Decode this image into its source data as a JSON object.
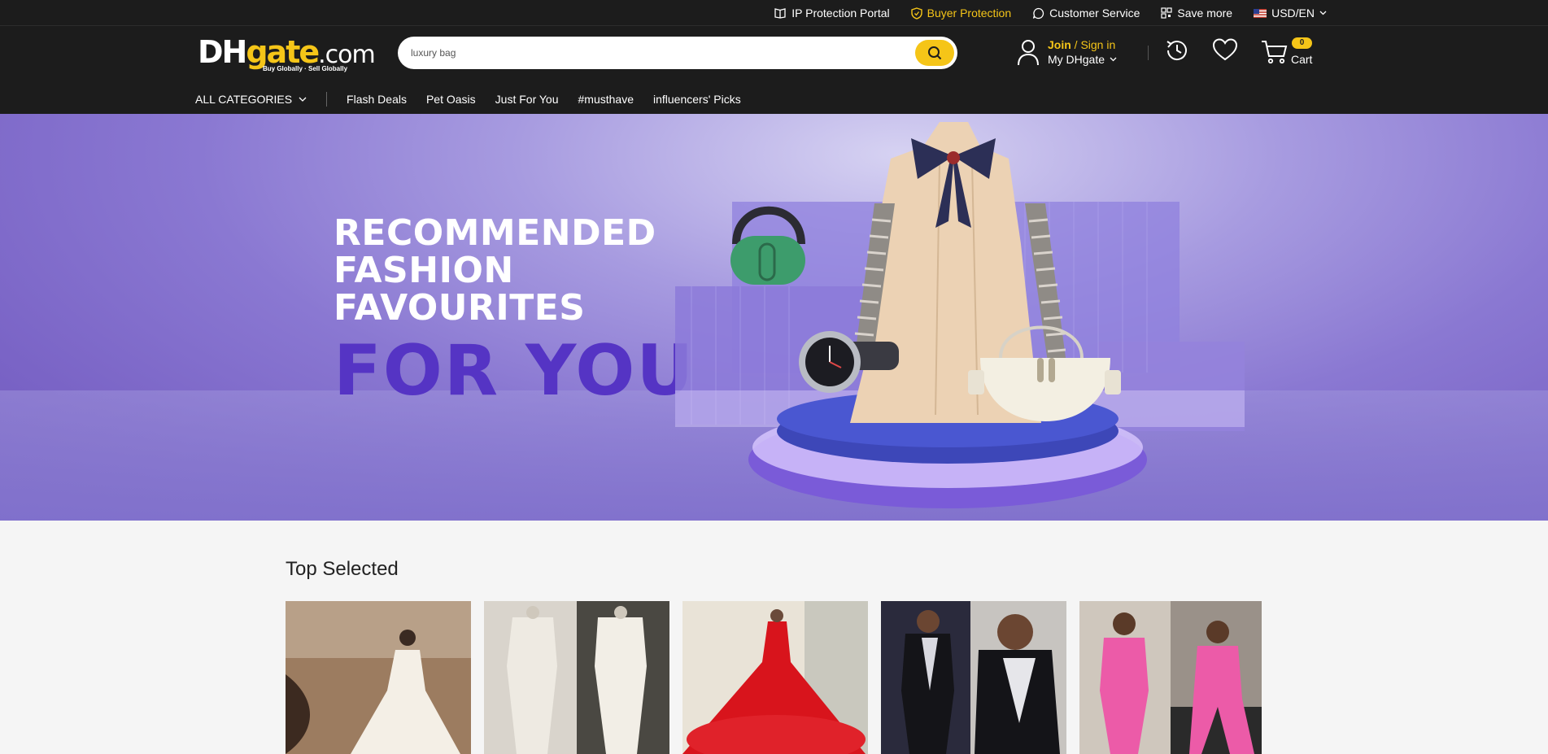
{
  "topbar": {
    "ip_protection": "IP Protection Portal",
    "buyer_protection": "Buyer Protection",
    "customer_service": "Customer Service",
    "save_more": "Save more",
    "currency_lang": "USD/EN"
  },
  "header": {
    "logo_text_dh": "DH",
    "logo_text_gate": "gate",
    "logo_text_com": ".com",
    "logo_tagline": "Buy Globally · Sell Globally",
    "search_value": "luxury bag",
    "join": "Join",
    "sign_in": " / Sign in",
    "my_dhgate": "My DHgate",
    "cart_count": "0",
    "cart_label": "Cart"
  },
  "nav": {
    "all_categories": "ALL CATEGORIES",
    "items": [
      "Flash Deals",
      "Pet Oasis",
      "Just For You",
      "#musthave",
      "influencers' Picks"
    ]
  },
  "banner": {
    "line1": "RECOMMENDED",
    "line2": "FASHION",
    "line3": "FAVOURITES",
    "line4": "FOR YOU"
  },
  "top_selected": {
    "title": "Top Selected"
  },
  "colors": {
    "bar_bg": "#1c1c1c",
    "accent": "#f5c518",
    "banner_purple": "#8a78d2",
    "headline_purple": "#5534c4"
  }
}
